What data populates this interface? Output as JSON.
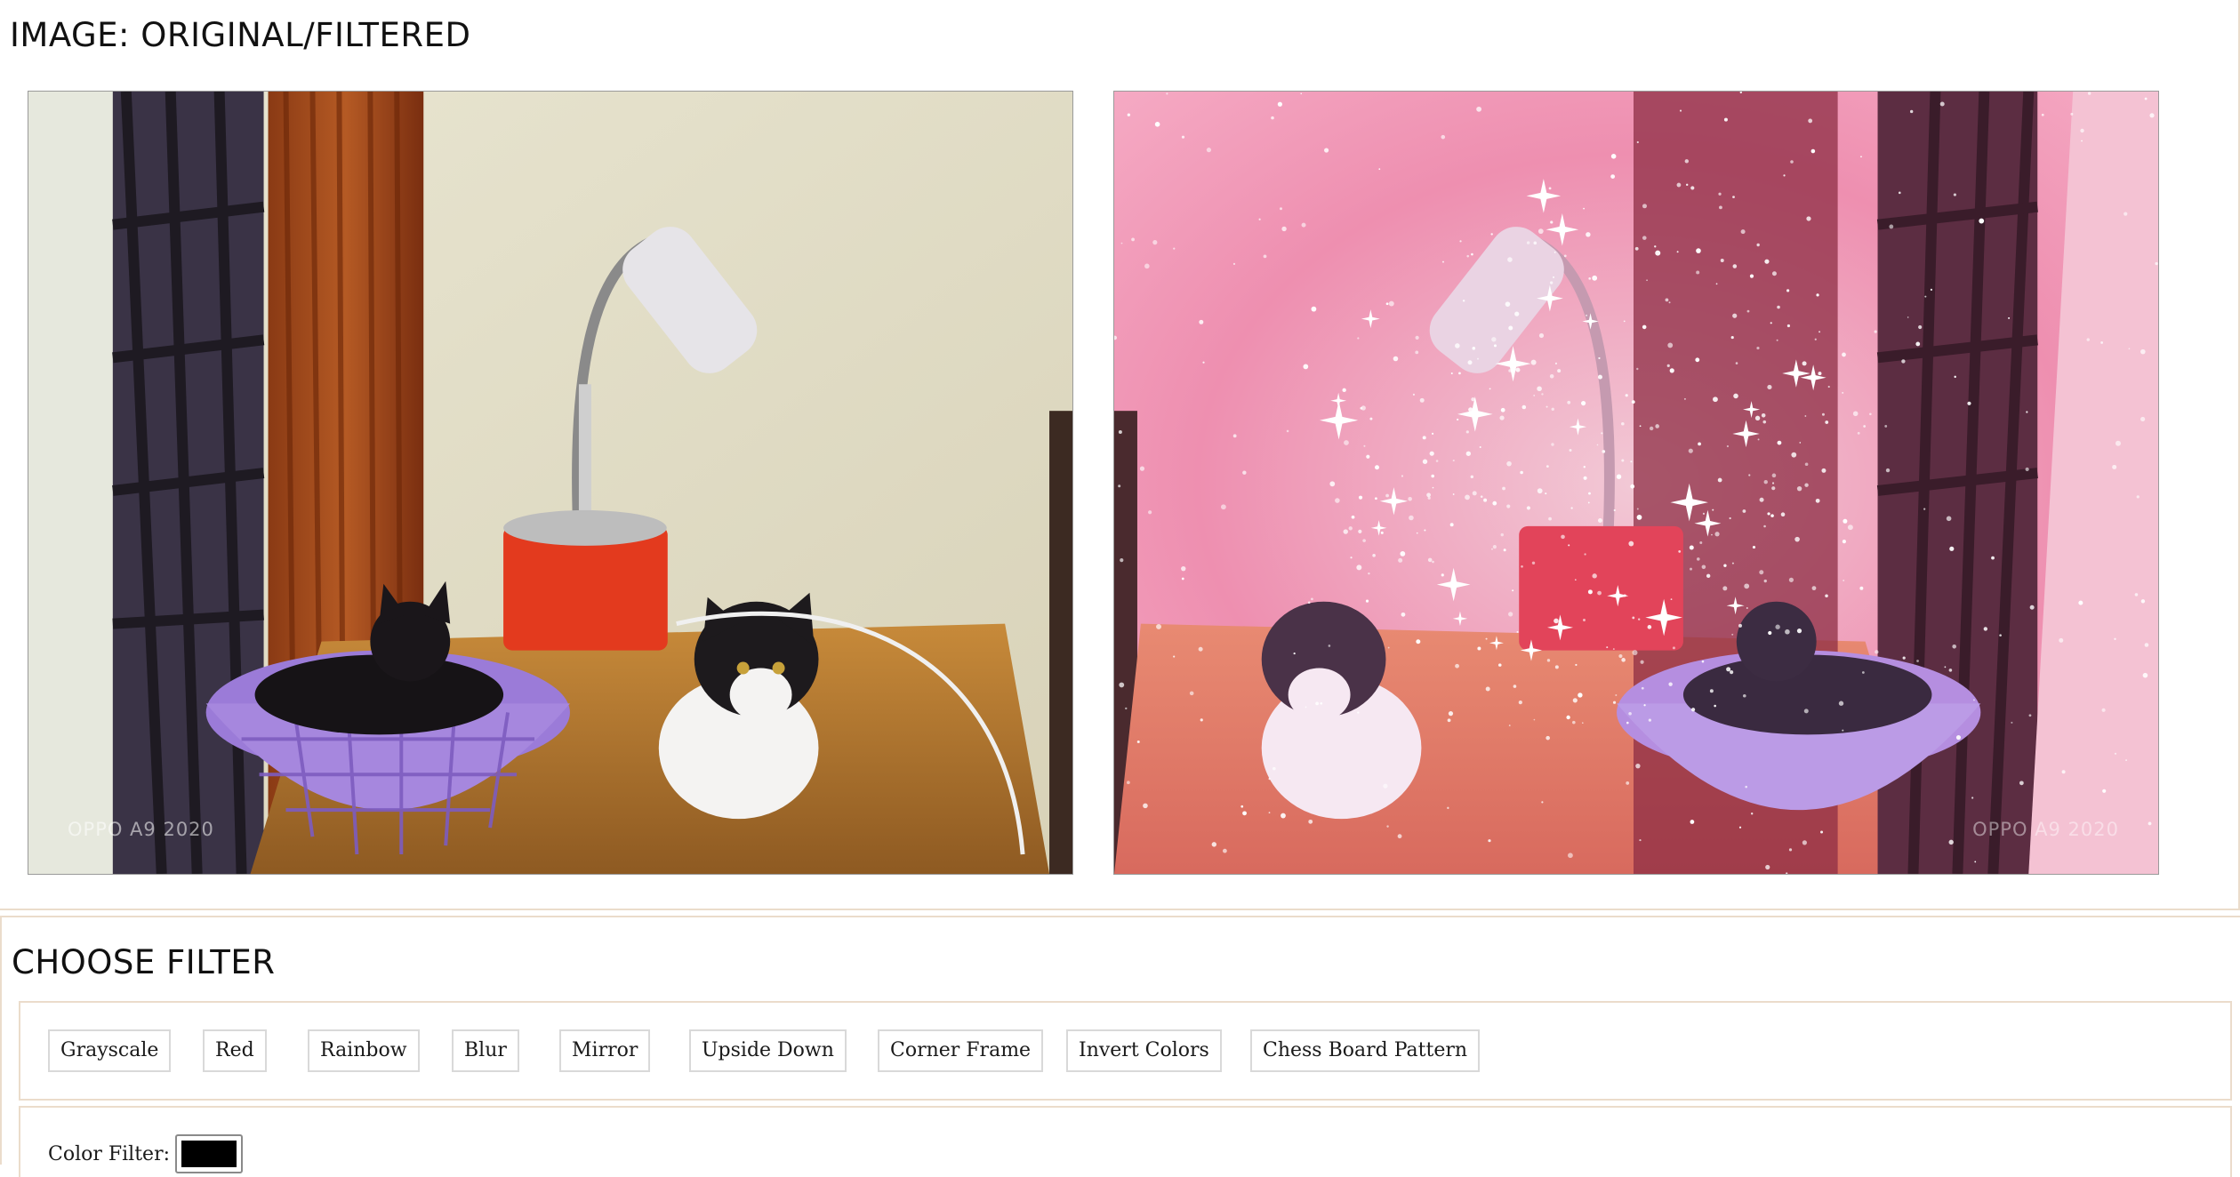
{
  "images_section": {
    "title": "IMAGE: ORIGINAL/FILTERED",
    "original_watermark": "OPPO A9 2020",
    "filtered_watermark": "OPPO A9 2020"
  },
  "filters_section": {
    "title": "CHOOSE FILTER",
    "buttons": [
      "Grayscale",
      "Red",
      "Rainbow",
      "Blur",
      "Mirror",
      "Upside Down",
      "Corner Frame",
      "Invert Colors",
      "Chess Board Pattern"
    ],
    "color_filter_label": "Color Filter:",
    "color_filter_value": "#000000"
  }
}
